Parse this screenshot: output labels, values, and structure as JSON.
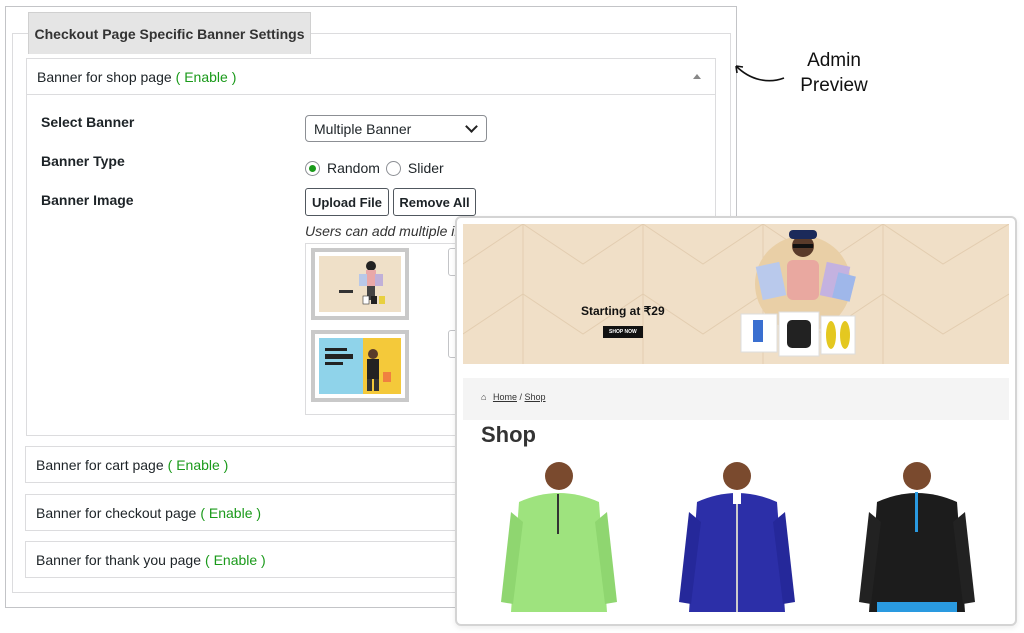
{
  "admin": {
    "section_tab": "Checkout Page Specific Banner Settings",
    "panel": {
      "title": "Banner for shop page",
      "status": "( Enable )",
      "select_banner_label": "Select Banner",
      "select_banner_value": "Multiple Banner",
      "banner_type_label": "Banner Type",
      "banner_type_options": [
        "Random",
        "Slider"
      ],
      "banner_type_selected": "Random",
      "banner_image_label": "Banner Image",
      "upload_button": "Upload File",
      "remove_button": "Remove All",
      "note": "Users can add multiple in"
    },
    "accordions": [
      {
        "title": "Banner for cart page",
        "status": "( Enable )"
      },
      {
        "title": "Banner for checkout page",
        "status": "( Enable )"
      },
      {
        "title": "Banner for thank you page",
        "status": "( Enable )"
      }
    ]
  },
  "annotation": {
    "line1": "Admin",
    "line2": "Preview"
  },
  "preview": {
    "hero_text": "Starting at ₹29",
    "hero_button": "SHOP NOW",
    "breadcrumb": {
      "home": "Home",
      "separator": "/",
      "current": "Shop"
    },
    "title": "Shop"
  },
  "colors": {
    "enable_green": "#1a9a1a",
    "hero_bg": "#f0dfc7"
  }
}
